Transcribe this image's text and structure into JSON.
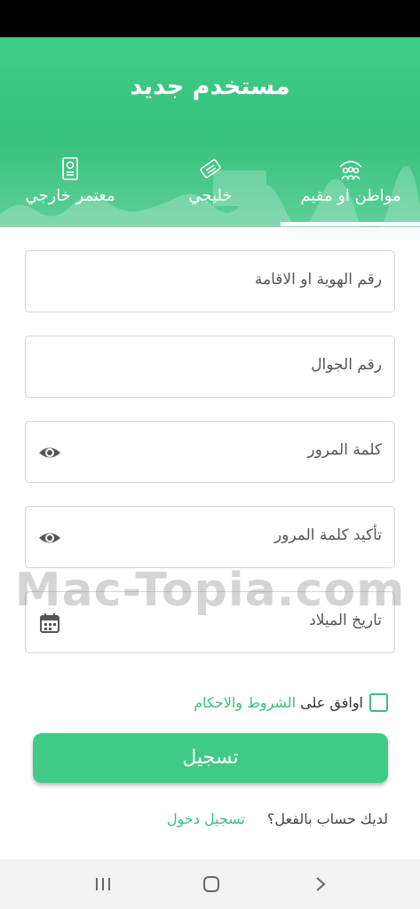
{
  "header": {
    "title": "مستخدم جديد",
    "accent_color": "#37c27d"
  },
  "tabs": [
    {
      "label": "مواطن او مقيم",
      "icon": "group-icon",
      "active": true
    },
    {
      "label": "خليجي",
      "icon": "id-card-icon",
      "active": false
    },
    {
      "label": "معتمر خارجي",
      "icon": "passport-icon",
      "active": false
    }
  ],
  "form": {
    "id_field": {
      "placeholder": "رقم الهوية او الاقامة"
    },
    "phone_field": {
      "placeholder": "رقم الجوال"
    },
    "password_field": {
      "placeholder": "كلمة المرور",
      "icon": "eye-icon"
    },
    "confirm_password_field": {
      "placeholder": "تأكيد كلمة المرور",
      "icon": "eye-icon"
    },
    "birthdate_field": {
      "placeholder": "تاريخ الميلاد",
      "icon": "calendar-icon"
    }
  },
  "agreement": {
    "text": "اوافق على",
    "link": "الشروط والاحكام",
    "checked": false
  },
  "submit": {
    "label": "تسجيل"
  },
  "login": {
    "question": "لديك حساب بالفعل؟",
    "link": "تسجيل دخول"
  },
  "watermark": "Mac-Topia.com",
  "navbar": {
    "recents_icon": "recents-icon",
    "home_icon": "home-icon",
    "back_icon": "back-icon"
  }
}
